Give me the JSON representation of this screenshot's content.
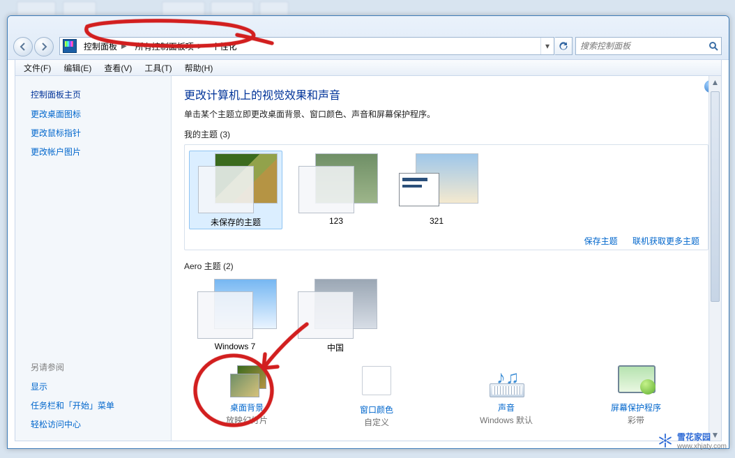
{
  "window": {
    "breadcrumb": [
      "控制面板",
      "所有控制面板项",
      "个性化"
    ],
    "search_placeholder": "搜索控制面板"
  },
  "menubar": [
    "文件(F)",
    "编辑(E)",
    "查看(V)",
    "工具(T)",
    "帮助(H)"
  ],
  "leftpane": {
    "title": "控制面板主页",
    "links": [
      "更改桌面图标",
      "更改鼠标指针",
      "更改帐户图片"
    ],
    "seealso_title": "另请参阅",
    "seealso": [
      "显示",
      "任务栏和「开始」菜单",
      "轻松访问中心"
    ]
  },
  "main": {
    "heading": "更改计算机上的视觉效果和声音",
    "desc": "单击某个主题立即更改桌面背景、窗口颜色、声音和屏幕保护程序。",
    "my_themes_header": "我的主题 (3)",
    "my_themes": [
      {
        "name": "未保存的主题",
        "selected": true
      },
      {
        "name": "123",
        "selected": false
      },
      {
        "name": "321",
        "selected": false
      }
    ],
    "actions": {
      "save": "保存主题",
      "online": "联机获取更多主题"
    },
    "aero_header": "Aero 主题 (2)",
    "aero_themes": [
      {
        "name": "Windows 7"
      },
      {
        "name": "中国"
      }
    ],
    "shortcuts": {
      "bg": {
        "label": "桌面背景",
        "sub": "放映幻灯片"
      },
      "color": {
        "label": "窗口颜色",
        "sub": "自定义"
      },
      "sound": {
        "label": "声音",
        "sub": "Windows 默认"
      },
      "saver": {
        "label": "屏幕保护程序",
        "sub": "彩带"
      }
    }
  },
  "watermark": {
    "brand": "雪花家园",
    "url": "www.xhjaty.com"
  }
}
